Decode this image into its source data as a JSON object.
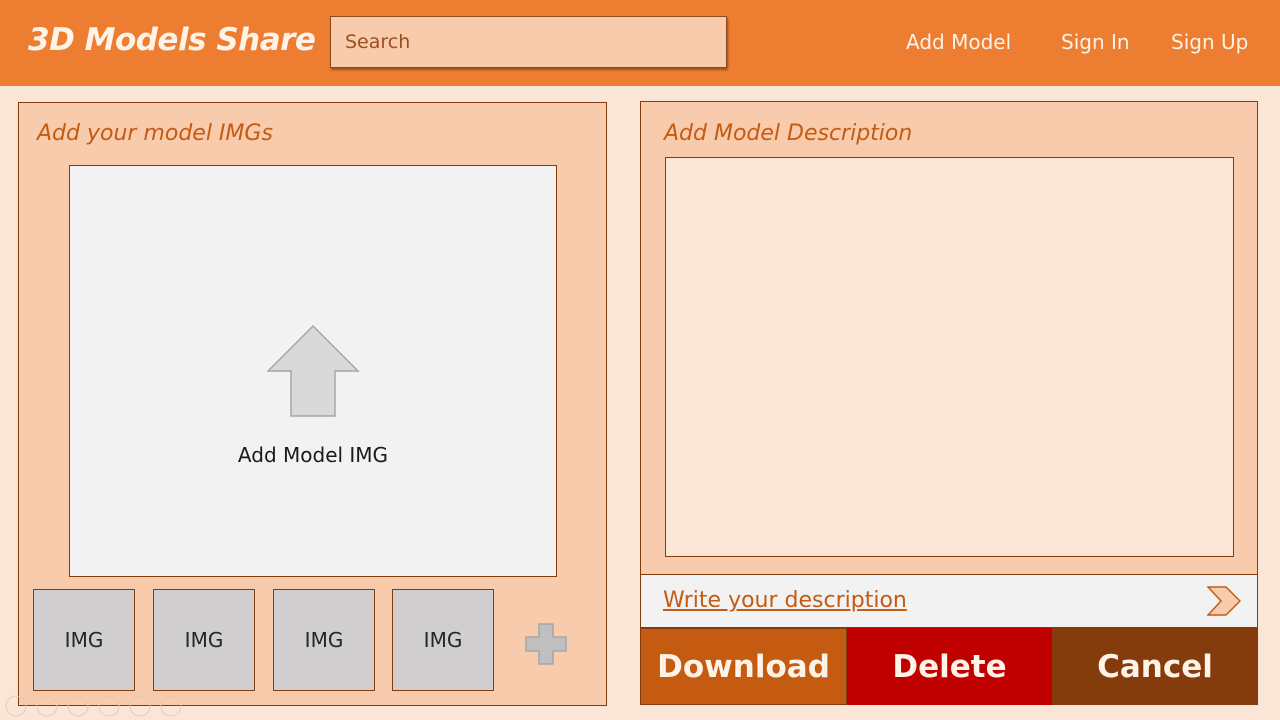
{
  "header": {
    "logo": "3D Models Share",
    "search_placeholder": "Search",
    "nav": {
      "add_model": "Add Model",
      "sign_in": "Sign In",
      "sign_up": "Sign Up"
    }
  },
  "images_panel": {
    "title": "Add your model IMGs",
    "dropzone_label": "Add Model IMG",
    "thumbnails": [
      "IMG",
      "IMG",
      "IMG",
      "IMG"
    ]
  },
  "description_panel": {
    "title": "Add Model Description",
    "input_text": "Write your description"
  },
  "actions": {
    "download": "Download",
    "delete": "Delete",
    "cancel": "Cancel"
  },
  "icons": {
    "upload": "upload-arrow-icon",
    "add": "plus-icon",
    "send": "chevron-right-icon"
  },
  "colors": {
    "header": "#ed7d31",
    "panel": "#f8cbad",
    "background": "#fbe5d6",
    "download": "#c55a11",
    "delete": "#c00000",
    "cancel": "#843c0c"
  }
}
